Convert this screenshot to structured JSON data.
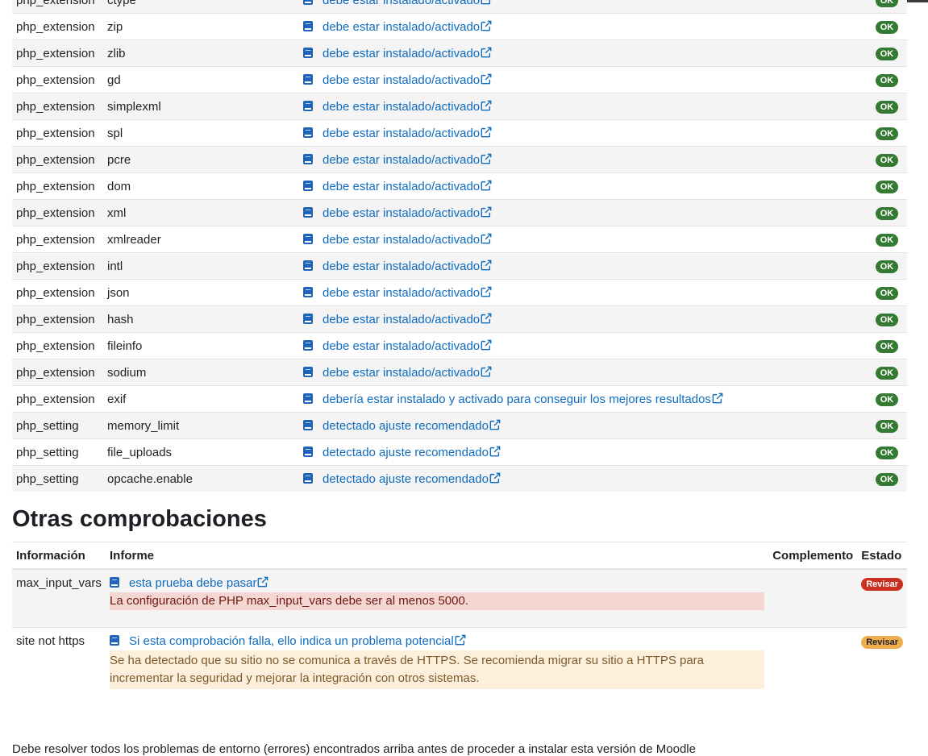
{
  "environment": {
    "rows": [
      {
        "type": "php_extension",
        "name": "ctype",
        "report": "debe estar instalado/activado",
        "status": "OK"
      },
      {
        "type": "php_extension",
        "name": "zip",
        "report": "debe estar instalado/activado",
        "status": "OK"
      },
      {
        "type": "php_extension",
        "name": "zlib",
        "report": "debe estar instalado/activado",
        "status": "OK"
      },
      {
        "type": "php_extension",
        "name": "gd",
        "report": "debe estar instalado/activado",
        "status": "OK"
      },
      {
        "type": "php_extension",
        "name": "simplexml",
        "report": "debe estar instalado/activado",
        "status": "OK"
      },
      {
        "type": "php_extension",
        "name": "spl",
        "report": "debe estar instalado/activado",
        "status": "OK"
      },
      {
        "type": "php_extension",
        "name": "pcre",
        "report": "debe estar instalado/activado",
        "status": "OK"
      },
      {
        "type": "php_extension",
        "name": "dom",
        "report": "debe estar instalado/activado",
        "status": "OK"
      },
      {
        "type": "php_extension",
        "name": "xml",
        "report": "debe estar instalado/activado",
        "status": "OK"
      },
      {
        "type": "php_extension",
        "name": "xmlreader",
        "report": "debe estar instalado/activado",
        "status": "OK"
      },
      {
        "type": "php_extension",
        "name": "intl",
        "report": "debe estar instalado/activado",
        "status": "OK"
      },
      {
        "type": "php_extension",
        "name": "json",
        "report": "debe estar instalado/activado",
        "status": "OK"
      },
      {
        "type": "php_extension",
        "name": "hash",
        "report": "debe estar instalado/activado",
        "status": "OK"
      },
      {
        "type": "php_extension",
        "name": "fileinfo",
        "report": "debe estar instalado/activado",
        "status": "OK"
      },
      {
        "type": "php_extension",
        "name": "sodium",
        "report": "debe estar instalado/activado",
        "status": "OK"
      },
      {
        "type": "php_extension",
        "name": "exif",
        "report": "debería estar instalado y activado para conseguir los mejores resultados",
        "status": "OK"
      },
      {
        "type": "php_setting",
        "name": "memory_limit",
        "report": "detectado ajuste recomendado",
        "status": "OK"
      },
      {
        "type": "php_setting",
        "name": "file_uploads",
        "report": "detectado ajuste recomendado",
        "status": "OK"
      },
      {
        "type": "php_setting",
        "name": "opcache.enable",
        "report": "detectado ajuste recomendado",
        "status": "OK"
      }
    ]
  },
  "other_checks": {
    "title": "Otras comprobaciones",
    "headers": {
      "info": "Información",
      "report": "Informe",
      "plugin": "Complemento",
      "status": "Estado"
    },
    "rows": [
      {
        "info": "max_input_vars",
        "link": "esta prueba debe pasar",
        "message": "La configuración de PHP max_input_vars debe ser al menos 5000.",
        "status": "Revisar"
      },
      {
        "info": "site not https",
        "link": "Si esta comprobación falla, ello indica un problema potencial",
        "message": "Se ha detectado que su sitio no se comunica a través de HTTPS. Se recomienda migrar su sitio a HTTPS para incrementar la seguridad y mejorar la integración con otros sistemas.",
        "status": "Revisar"
      }
    ]
  },
  "footer": {
    "text": "Debe resolver todos los problemas de entorno (errores) encontrados arriba antes de proceder a instalar esta versión de Moodle"
  },
  "colors": {
    "link": "#0f6cbf",
    "ok": "#357a32",
    "error": "#ca3120",
    "warning": "#f0ad4e"
  }
}
